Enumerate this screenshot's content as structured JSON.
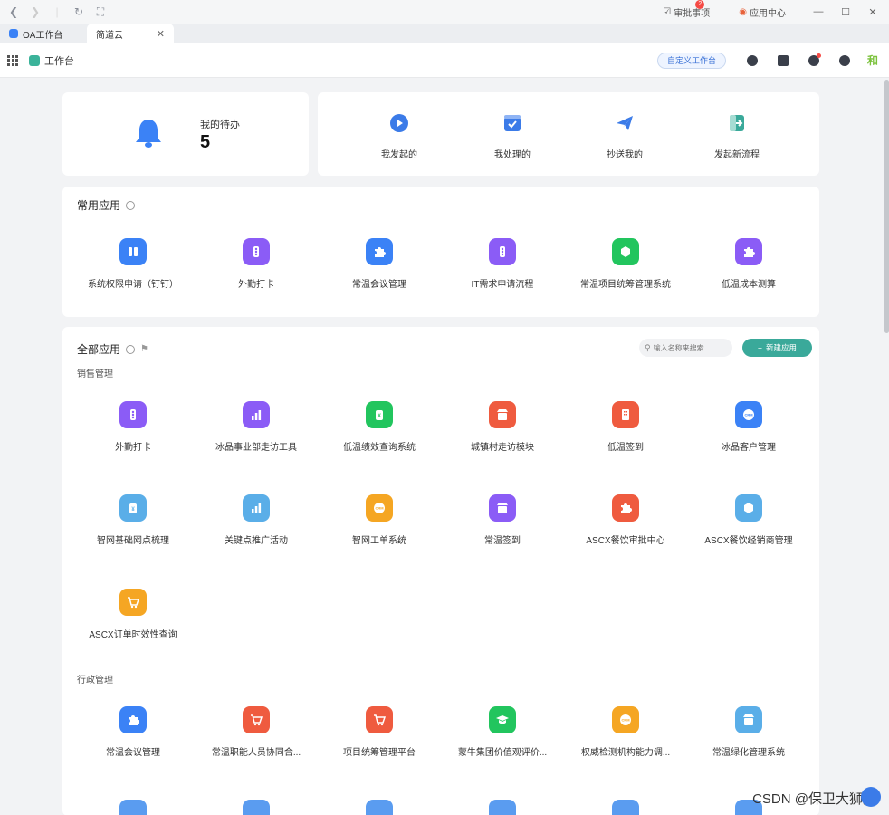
{
  "browser": {
    "approval_label": "审批事项",
    "approval_badge": "2",
    "app_center_label": "应用中心",
    "tabs": [
      {
        "label": "OA工作台"
      },
      {
        "label": "简道云"
      }
    ]
  },
  "header": {
    "title": "工作台",
    "custom_button": "自定义工作台",
    "avatar_text": "和"
  },
  "todo": {
    "label": "我的待办",
    "count": "5"
  },
  "flows": [
    {
      "label": "我发起的",
      "icon": "play-icon",
      "color": "#3b7be8"
    },
    {
      "label": "我处理的",
      "icon": "checkbox-icon",
      "color": "#3b7be8"
    },
    {
      "label": "抄送我的",
      "icon": "paper-plane-icon",
      "color": "#3b7be8"
    },
    {
      "label": "发起新流程",
      "icon": "exit-icon",
      "color": "#3aa99a"
    }
  ],
  "common_apps": {
    "title": "常用应用",
    "items": [
      {
        "label": "系统权限申请（钉钉）",
        "color": "#3b82f6",
        "icon": "columns-icon"
      },
      {
        "label": "外勤打卡",
        "color": "#8b5cf6",
        "icon": "traffic-light-icon"
      },
      {
        "label": "常温会议管理",
        "color": "#3b82f6",
        "icon": "puzzle-icon"
      },
      {
        "label": "IT需求申请流程",
        "color": "#8b5cf6",
        "icon": "traffic-light-icon"
      },
      {
        "label": "常温项目统筹管理系统",
        "color": "#22c55e",
        "icon": "hexagon-icon"
      },
      {
        "label": "低温成本测算",
        "color": "#8b5cf6",
        "icon": "puzzle-icon"
      }
    ]
  },
  "all_apps": {
    "title": "全部应用",
    "search_placeholder": "输入名称来搜索",
    "new_button": "新建应用",
    "groups": [
      {
        "title": "销售管理",
        "items": [
          {
            "label": "外勤打卡",
            "color": "#8b5cf6",
            "icon": "traffic-light-icon"
          },
          {
            "label": "冰品事业部走访工具",
            "color": "#8b5cf6",
            "icon": "bar-chart-icon"
          },
          {
            "label": "低温绩效查询系统",
            "color": "#22c55e",
            "icon": "bottle-icon"
          },
          {
            "label": "城镇村走访模块",
            "color": "#ef5b3f",
            "icon": "shop-icon"
          },
          {
            "label": "低温签到",
            "color": "#ef5b3f",
            "icon": "building-icon"
          },
          {
            "label": "冰品客户管理",
            "color": "#3b82f6",
            "icon": "crm-icon"
          },
          {
            "label": "智网基础网点梳理",
            "color": "#5aaee8",
            "icon": "bottle-icon"
          },
          {
            "label": "关键点推广活动",
            "color": "#5aaee8",
            "icon": "bar-chart-icon"
          },
          {
            "label": "智网工单系统",
            "color": "#f5a623",
            "icon": "crm-icon"
          },
          {
            "label": "常温签到",
            "color": "#8b5cf6",
            "icon": "shop-icon"
          },
          {
            "label": "ASCX餐饮审批中心",
            "color": "#ef5b3f",
            "icon": "puzzle-icon"
          },
          {
            "label": "ASCX餐饮经销商管理",
            "color": "#5aaee8",
            "icon": "hexagon-icon"
          },
          {
            "label": "ASCX订单时效性查询",
            "color": "#f5a623",
            "icon": "cart-icon"
          }
        ]
      },
      {
        "title": "行政管理",
        "items": [
          {
            "label": "常温会议管理",
            "color": "#3b82f6",
            "icon": "puzzle-icon"
          },
          {
            "label": "常温职能人员协同合...",
            "color": "#ef5b3f",
            "icon": "cart-icon"
          },
          {
            "label": "项目统筹管理平台",
            "color": "#ef5b3f",
            "icon": "cart-icon"
          },
          {
            "label": "蒙牛集团价值观评价...",
            "color": "#22c55e",
            "icon": "graduation-cap-icon"
          },
          {
            "label": "权威检测机构能力调...",
            "color": "#f5a623",
            "icon": "crm-icon"
          },
          {
            "label": "常温绿化管理系统",
            "color": "#5aaee8",
            "icon": "shop-icon"
          }
        ]
      }
    ]
  },
  "watermark": "CSDN @保卫大狮兄"
}
